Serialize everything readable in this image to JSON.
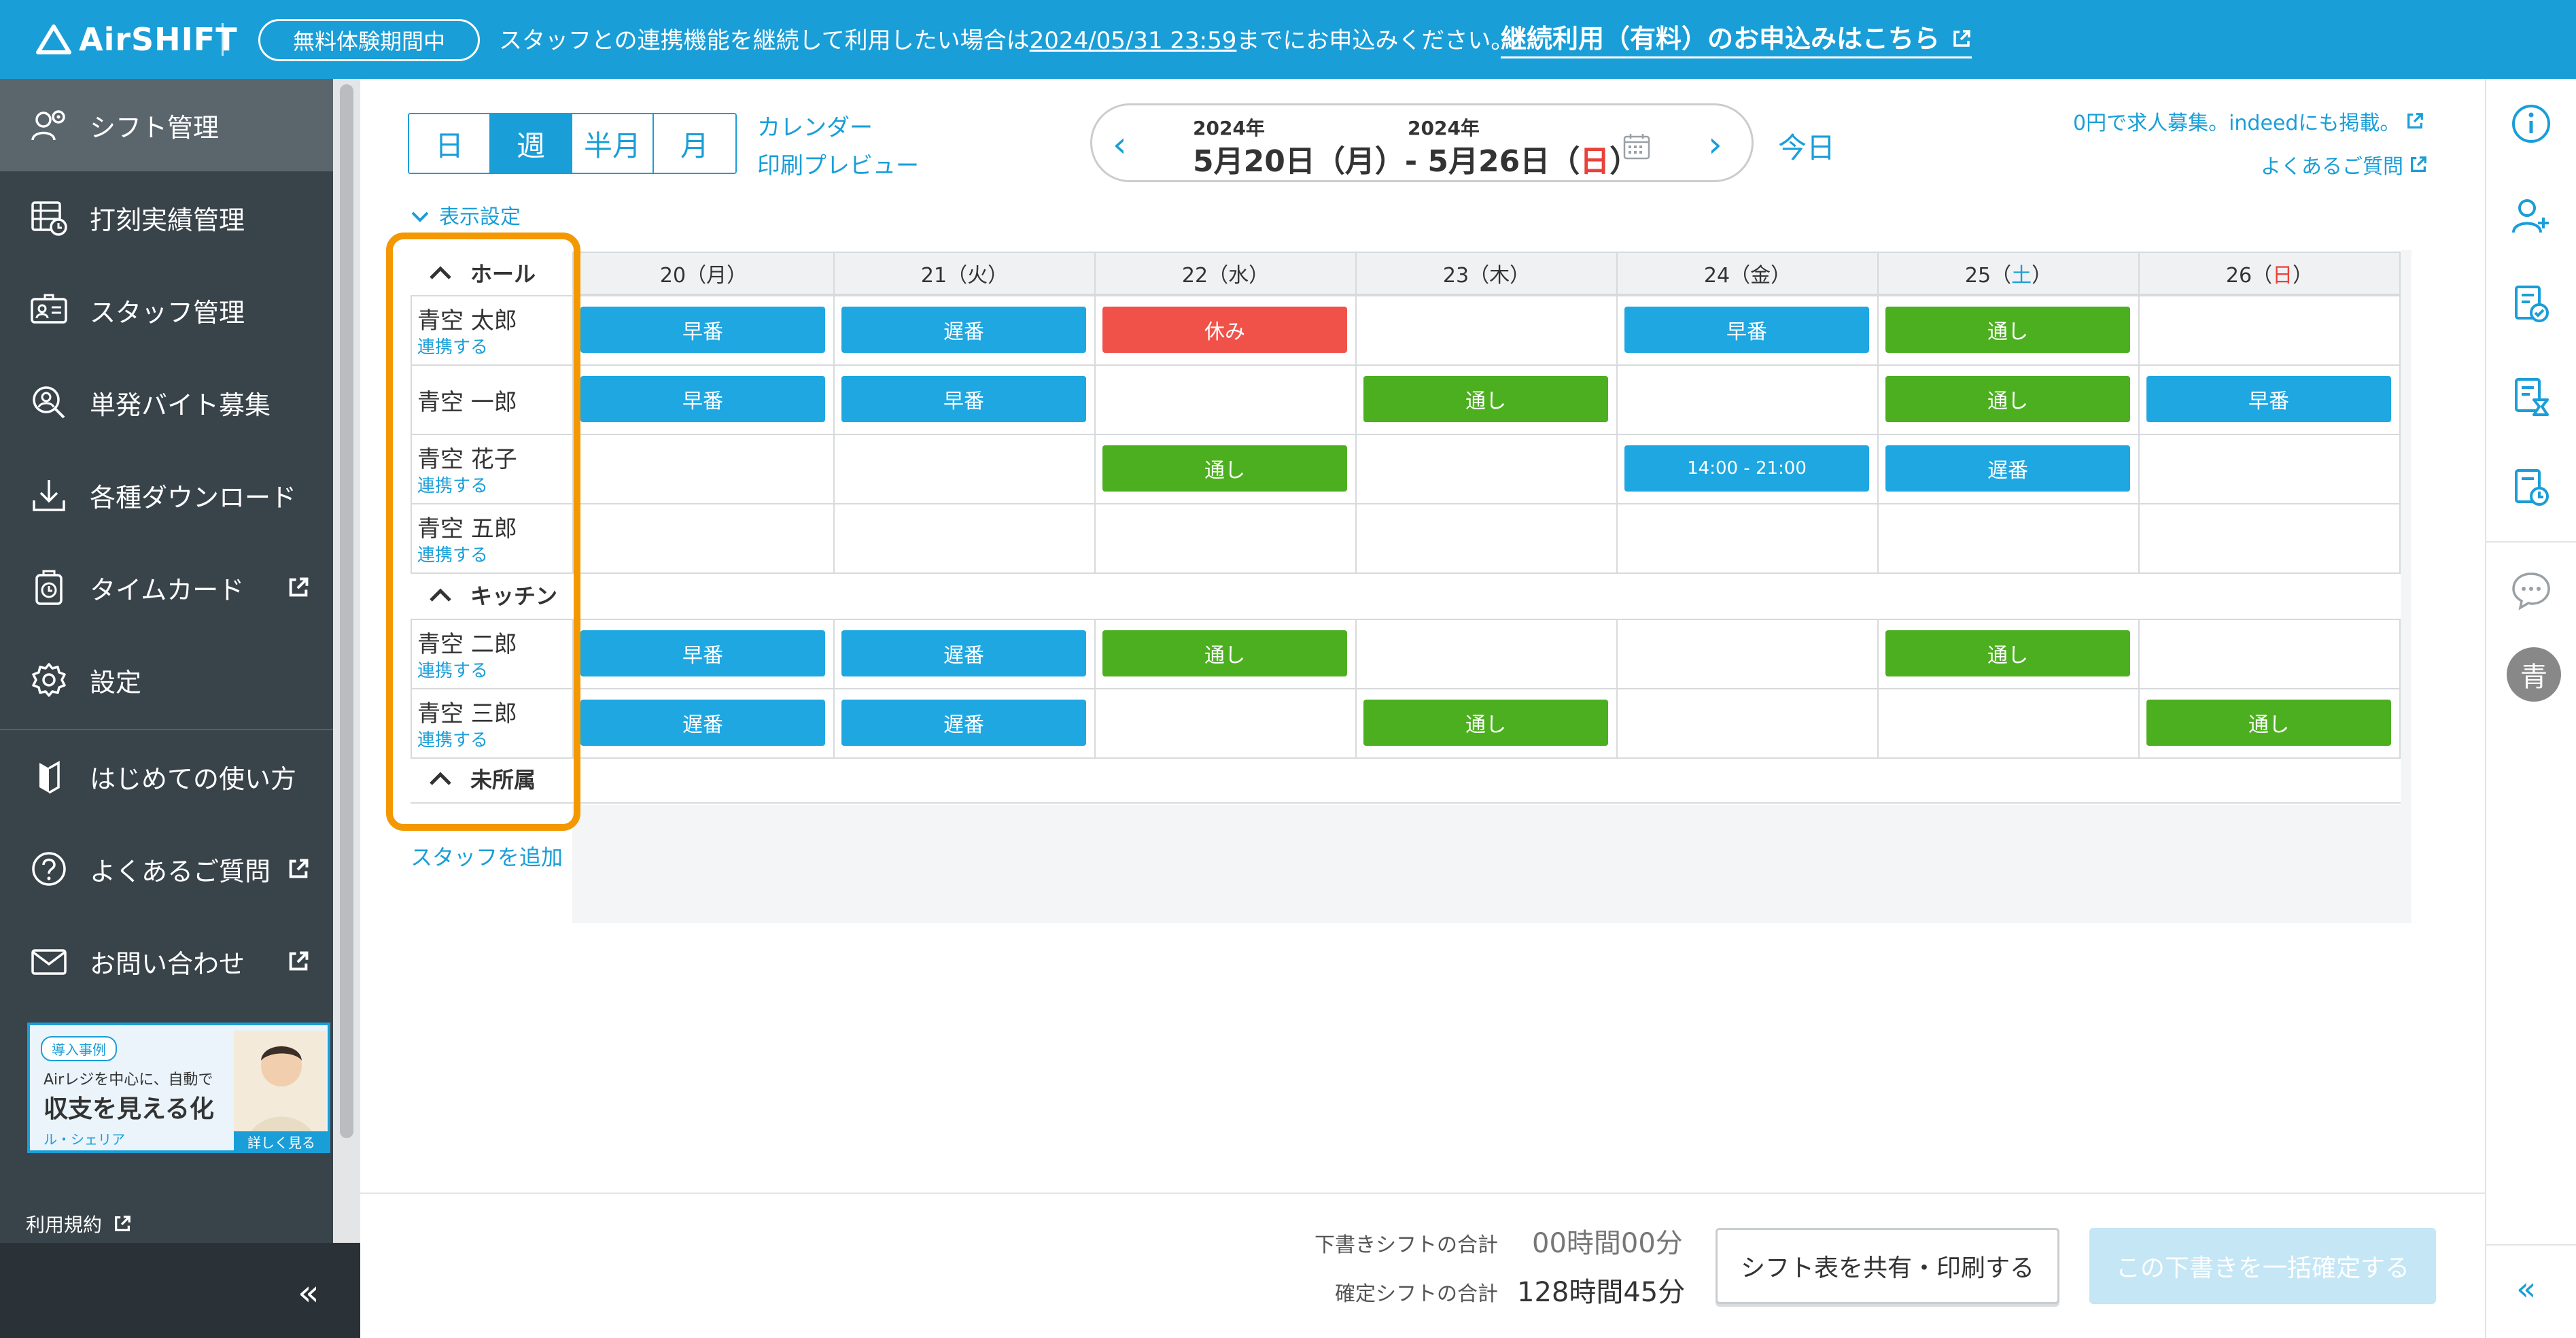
{
  "banner": {
    "logo": "AirSHIFT",
    "trial_badge": "無料体験期間中",
    "message_pre": "スタッフとの連携機能を継続して利用したい場合は",
    "deadline": "2024/05/31 23:59",
    "message_post": "までにお申込みください。",
    "cta": "継続利用（有料）のお申込みはこちら"
  },
  "sidebar": {
    "items": [
      {
        "label": "シフト管理",
        "icon": "people-gear-icon"
      },
      {
        "label": "打刻実績管理",
        "icon": "timesheet-icon"
      },
      {
        "label": "スタッフ管理",
        "icon": "id-card-icon"
      },
      {
        "label": "単発バイト募集",
        "icon": "person-search-icon"
      },
      {
        "label": "各種ダウンロード",
        "icon": "download-icon"
      },
      {
        "label": "タイムカード",
        "icon": "timecard-icon"
      },
      {
        "label": "設定",
        "icon": "gear-icon"
      },
      {
        "label": "はじめての使い方",
        "icon": "beginner-mark-icon"
      },
      {
        "label": "よくあるご質問",
        "icon": "question-icon"
      },
      {
        "label": "お問い合わせ",
        "icon": "mail-icon"
      }
    ],
    "promo": {
      "tag": "導入事例",
      "line1": "Airレジを中心に、自動で",
      "line2": "収支を見える化",
      "line3": "ル・シェリア",
      "more": "詳しく見る"
    },
    "terms": "利用規約",
    "collapse": "«"
  },
  "controls": {
    "views": [
      "日",
      "週",
      "半月",
      "月"
    ],
    "active_view": "週",
    "calendar_link": "カレンダー",
    "print_link": "印刷プレビュー",
    "date_nav": {
      "start_year": "2024年",
      "end_year": "2024年",
      "range_pre": "5月20日（月）- 5月26日（",
      "range_sun": "日",
      "range_post": "）",
      "prev": "‹",
      "next": "›"
    },
    "today": "今日",
    "job_link": "0円で求人募集。indeedにも掲載。",
    "faq_link": "よくあるご質問",
    "display_settings": "表示設定"
  },
  "schedule": {
    "days": [
      {
        "num": "20",
        "dow": "月"
      },
      {
        "num": "21",
        "dow": "火"
      },
      {
        "num": "22",
        "dow": "水"
      },
      {
        "num": "23",
        "dow": "木"
      },
      {
        "num": "24",
        "dow": "金"
      },
      {
        "num": "25",
        "dow": "土"
      },
      {
        "num": "26",
        "dow": "日"
      }
    ],
    "groups": [
      "ホール",
      "キッチン",
      "未所属"
    ],
    "staff": [
      {
        "name": "青空 太郎",
        "link": "連携する"
      },
      {
        "name": "青空 一郎",
        "link": ""
      },
      {
        "name": "青空 花子",
        "link": "連携する"
      },
      {
        "name": "青空 五郎",
        "link": "連携する"
      },
      {
        "name": "青空 二郎",
        "link": "連携する"
      },
      {
        "name": "青空 三郎",
        "link": "連携する"
      }
    ],
    "shifts": [
      [
        "早番",
        "遅番",
        "休み",
        "",
        "早番",
        "通し",
        ""
      ],
      [
        "早番",
        "早番",
        "",
        "通し",
        "",
        "通し",
        "早番"
      ],
      [
        "",
        "",
        "通し",
        "",
        "14:00 - 21:00",
        "遅番",
        ""
      ],
      [
        "",
        "",
        "",
        "",
        "",
        "",
        ""
      ],
      [
        "早番",
        "遅番",
        "通し",
        "",
        "",
        "通し",
        ""
      ],
      [
        "遅番",
        "遅番",
        "",
        "通し",
        "",
        "",
        "通し"
      ]
    ],
    "shift_colors": {
      "早番": "#1ea7e1",
      "遅番": "#1ea7e1",
      "14:00 - 21:00": "#1ea7e1",
      "通し": "#4caf1f",
      "休み": "#f0524a"
    },
    "add_staff": "スタッフを追加"
  },
  "footer": {
    "draft_label": "下書きシフトの合計",
    "draft_value": "00時間00分",
    "confirmed_label": "確定シフトの合計",
    "confirmed_value": "128時間45分",
    "share_button": "シフト表を共有・印刷する",
    "confirm_button": "この下書きを一括確定する"
  },
  "right_rail": {
    "avatar": "青"
  }
}
